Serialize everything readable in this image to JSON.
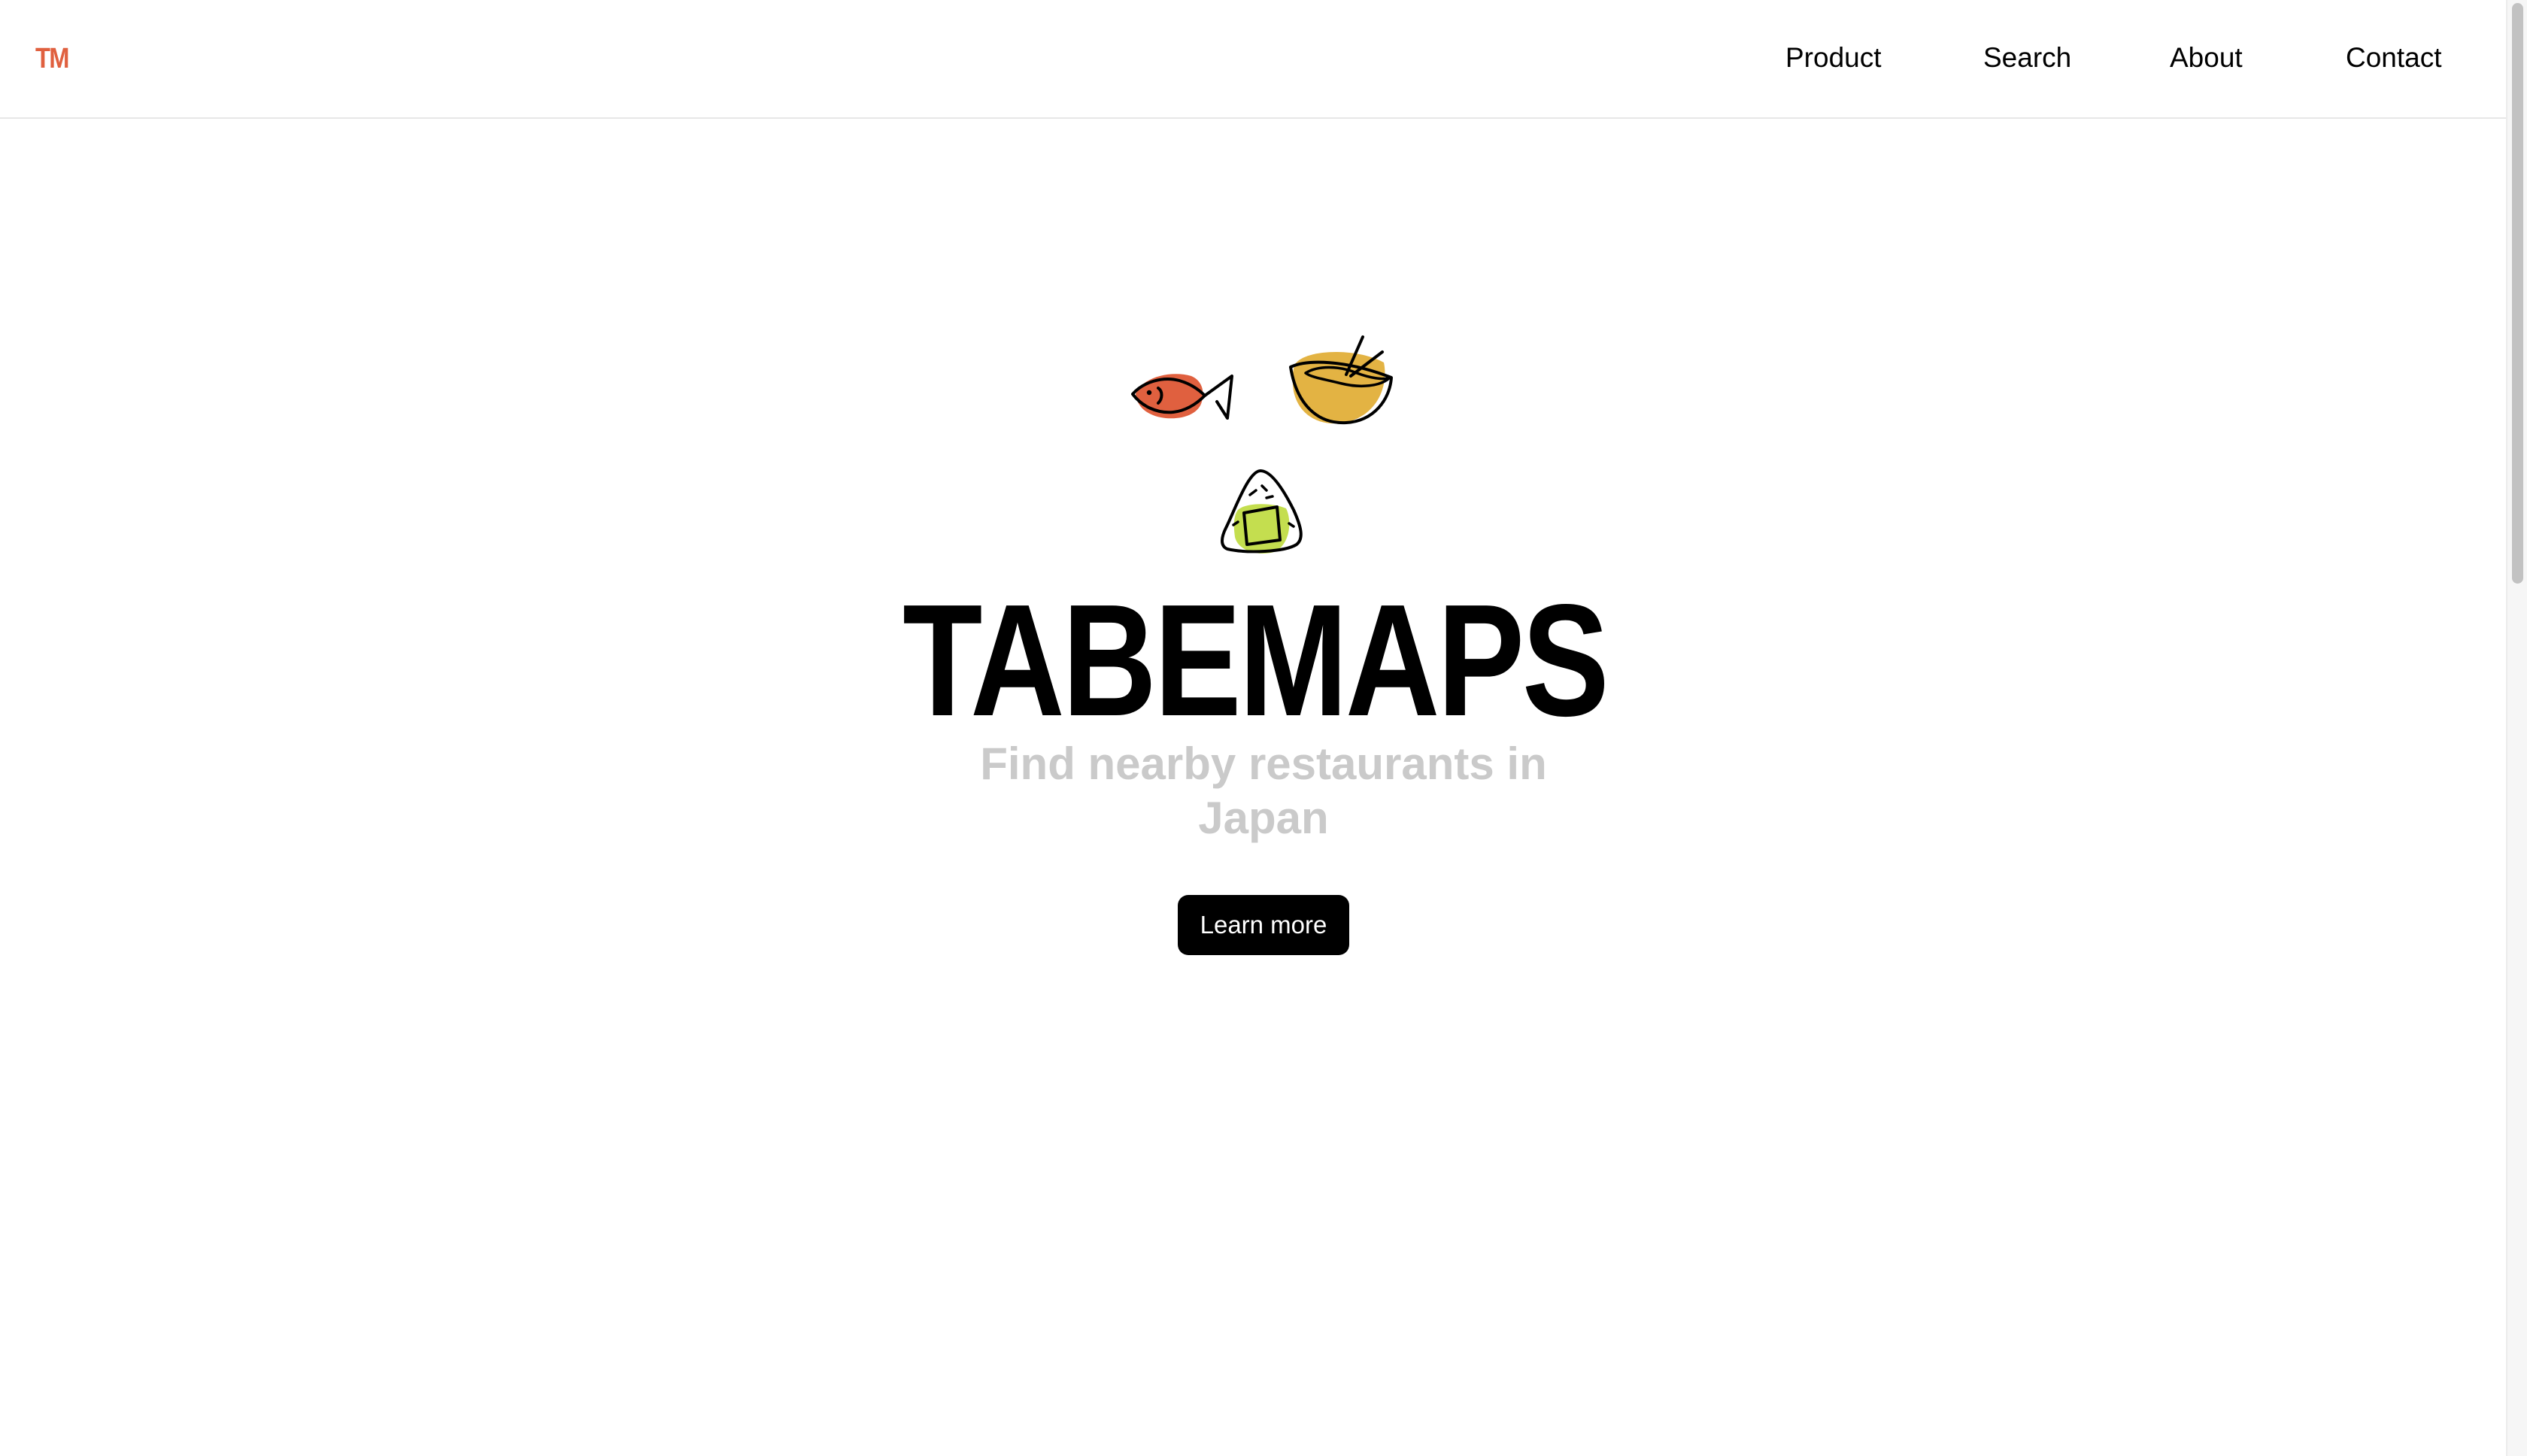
{
  "header": {
    "logo_text": "TM",
    "nav": [
      {
        "label": "Product"
      },
      {
        "label": "Search"
      },
      {
        "label": "About"
      },
      {
        "label": "Contact"
      }
    ]
  },
  "hero": {
    "icons": [
      "fish-icon",
      "ramen-bowl-icon",
      "onigiri-icon"
    ],
    "title": "TABEMAPS",
    "subtitle": "Find nearby restaurants in Japan",
    "cta_label": "Learn more"
  },
  "colors": {
    "brand": "#e0603f",
    "fish_blob": "#e0603f",
    "bowl_blob": "#e3b343",
    "onigiri_blob": "#c4de4f",
    "subtitle": "#cacaca",
    "button_bg": "#000000",
    "button_text": "#ffffff"
  }
}
